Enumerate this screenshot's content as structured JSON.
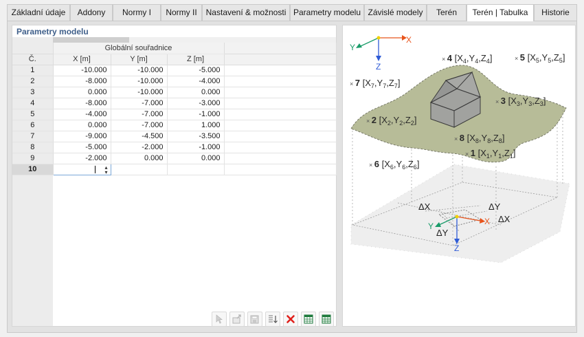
{
  "tabs": [
    {
      "label": "Základní údaje",
      "active": false
    },
    {
      "label": "Addony",
      "active": false
    },
    {
      "label": "Normy I",
      "active": false
    },
    {
      "label": "Normy II",
      "active": false
    },
    {
      "label": "Nastavení & možnosti",
      "active": false
    },
    {
      "label": "Parametry modelu",
      "active": false
    },
    {
      "label": "Závislé modely",
      "active": false
    },
    {
      "label": "Terén",
      "active": false
    },
    {
      "label": "Terén | Tabulka",
      "active": true
    },
    {
      "label": "Historie",
      "active": false
    }
  ],
  "panel": {
    "title": "Parametry modelu",
    "table": {
      "row_header": "Č.",
      "group_header": "Globální souřadnice",
      "columns": [
        "X [m]",
        "Y [m]",
        "Z [m]"
      ],
      "rows": [
        {
          "n": "1",
          "x": "-10.000",
          "y": "-10.000",
          "z": "-5.000"
        },
        {
          "n": "2",
          "x": "-8.000",
          "y": "-10.000",
          "z": "-4.000"
        },
        {
          "n": "3",
          "x": "0.000",
          "y": "-10.000",
          "z": "0.000"
        },
        {
          "n": "4",
          "x": "-8.000",
          "y": "-7.000",
          "z": "-3.000"
        },
        {
          "n": "5",
          "x": "-4.000",
          "y": "-7.000",
          "z": "-1.000"
        },
        {
          "n": "6",
          "x": "0.000",
          "y": "-7.000",
          "z": "1.000"
        },
        {
          "n": "7",
          "x": "-9.000",
          "y": "-4.500",
          "z": "-3.500"
        },
        {
          "n": "8",
          "x": "-5.000",
          "y": "-2.000",
          "z": "-1.000"
        },
        {
          "n": "9",
          "x": "-2.000",
          "y": "0.000",
          "z": "0.000"
        }
      ],
      "new_row": "10"
    }
  },
  "toolbar": [
    {
      "icon": "select-pointer-icon",
      "enabled": false
    },
    {
      "icon": "export-icon",
      "enabled": false
    },
    {
      "icon": "save-icon",
      "enabled": false
    },
    {
      "icon": "sort-icon",
      "enabled": true
    },
    {
      "icon": "delete-icon",
      "enabled": true,
      "color": "#e0201b"
    },
    {
      "icon": "excel-import-icon",
      "enabled": true,
      "color": "#1e7a3c"
    },
    {
      "icon": "excel-export-icon",
      "enabled": true,
      "color": "#1e7a3c"
    }
  ],
  "diagram": {
    "axes_top": {
      "x": "X",
      "y": "Y",
      "z": "Z"
    },
    "axes_bottom": {
      "x": "X",
      "y": "Y",
      "z": "Z"
    },
    "points": [
      {
        "num": "1",
        "var": "X",
        "sub": "1",
        "var2": "Y",
        "var3": "Z"
      },
      {
        "num": "2",
        "var": "X",
        "sub": "2",
        "var2": "Y",
        "var3": "Z"
      },
      {
        "num": "3",
        "var": "X",
        "sub": "3",
        "var2": "Y",
        "var3": "Z"
      },
      {
        "num": "4",
        "var": "X",
        "sub": "4",
        "var2": "Y",
        "var3": "Z"
      },
      {
        "num": "5",
        "var": "X",
        "sub": "5",
        "var2": "Y",
        "var3": "Z"
      },
      {
        "num": "6",
        "var": "X",
        "sub": "6",
        "var2": "Y",
        "var3": "Z"
      },
      {
        "num": "7",
        "var": "X",
        "sub": "7",
        "var2": "Y",
        "var3": "Z"
      },
      {
        "num": "8",
        "var": "X",
        "sub": "8",
        "var2": "Y",
        "var3": "Z"
      }
    ],
    "delta_labels": [
      "ΔX",
      "ΔY",
      "ΔX",
      "ΔY"
    ],
    "colors": {
      "terrain": "#b7bc98",
      "axis_x": "#e8541c",
      "axis_y": "#1a9c6a",
      "axis_z": "#2e5bd6",
      "origin": "#f0d000"
    }
  }
}
